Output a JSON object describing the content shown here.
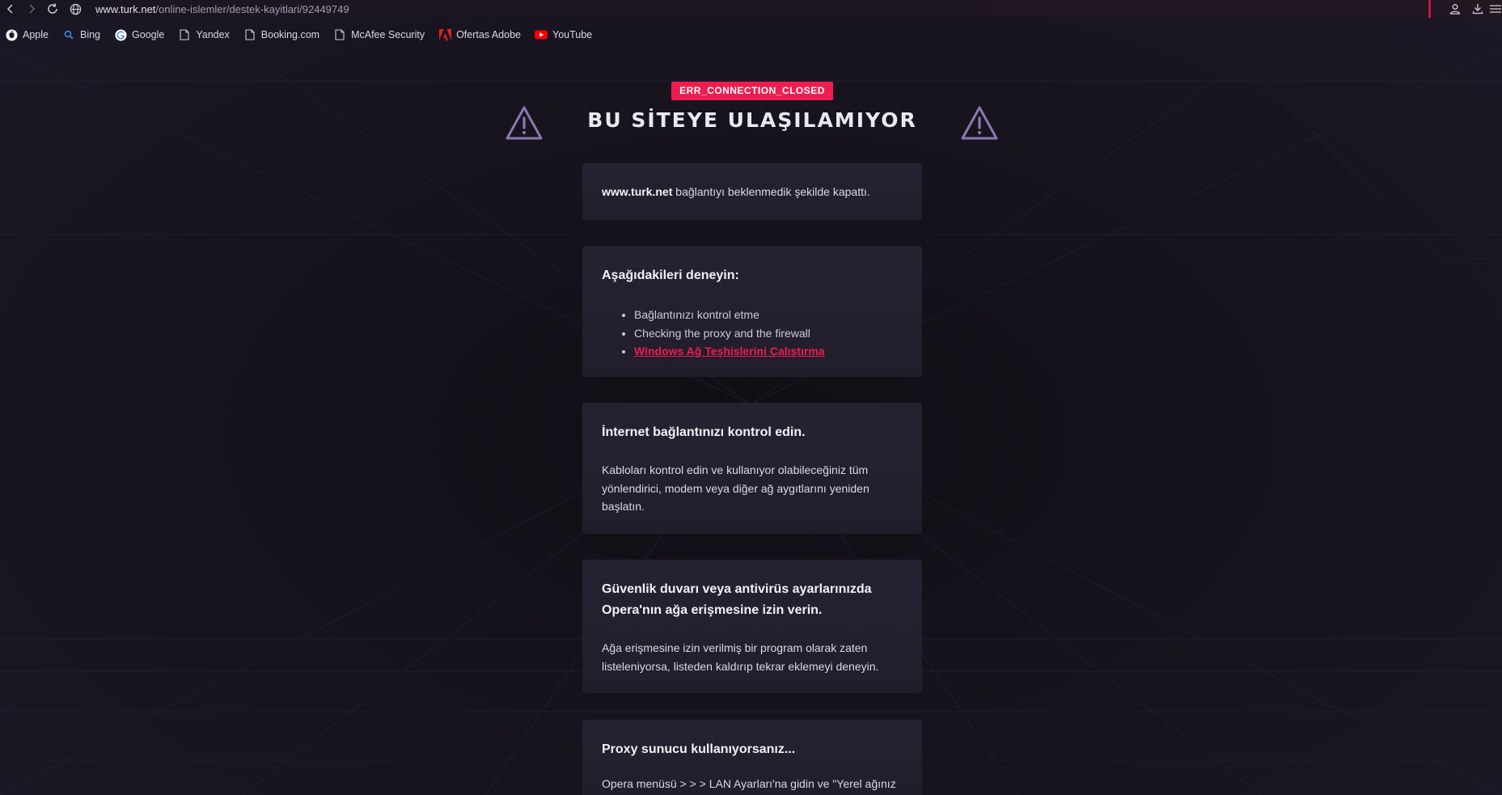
{
  "browser": {
    "url_domain": "www.turk.net",
    "url_path": "/online-islemler/destek-kayitlari/92449749"
  },
  "bookmarks": [
    {
      "label": "Apple",
      "icon": "apple-icon"
    },
    {
      "label": "Bing",
      "icon": "search-icon"
    },
    {
      "label": "Google",
      "icon": "google-icon"
    },
    {
      "label": "Yandex",
      "icon": "page-icon"
    },
    {
      "label": "Booking.com",
      "icon": "page-icon"
    },
    {
      "label": "McAfee Security",
      "icon": "page-icon"
    },
    {
      "label": "Ofertas Adobe",
      "icon": "adobe-icon"
    },
    {
      "label": "YouTube",
      "icon": "youtube-icon"
    }
  ],
  "error": {
    "code": "ERR_CONNECTION_CLOSED",
    "title": "BU SİTEYE ULAŞILAMIYOR"
  },
  "card1": {
    "domain": "www.turk.net",
    "text": " bağlantıyı beklenmedik şekilde kapattı."
  },
  "card2": {
    "heading": "Aşağıdakileri deneyin:",
    "items": [
      "Bağlantınızı kontrol etme",
      "Checking the proxy and the firewall"
    ],
    "link": "Windows Ağ Teşhislerini Çalıştırma"
  },
  "card3": {
    "heading": "İnternet bağlantınızı kontrol edin.",
    "text": "Kabloları kontrol edin ve kullanıyor olabileceğiniz tüm yönlendirici, modem veya diğer ağ aygıtlarını yeniden başlatın."
  },
  "card4": {
    "heading": "Güvenlik duvarı veya antivirüs ayarlarınızda Opera'nın ağa erişmesine izin verin.",
    "text": "Ağa erişmesine izin verilmiş bir program olarak zaten listeleniyorsa, listeden kaldırıp tekrar eklemeyi deneyin."
  },
  "card5": {
    "heading": "Proxy sunucu kullanıyorsanız...",
    "text": "Opera menüsü > > > LAN Ayarları'na gidin ve \"Yerel ağınız"
  },
  "colors": {
    "accent": "#ef1c50",
    "warning_icon": "#8a78b0",
    "background": "#13111a",
    "card": "#252030"
  }
}
